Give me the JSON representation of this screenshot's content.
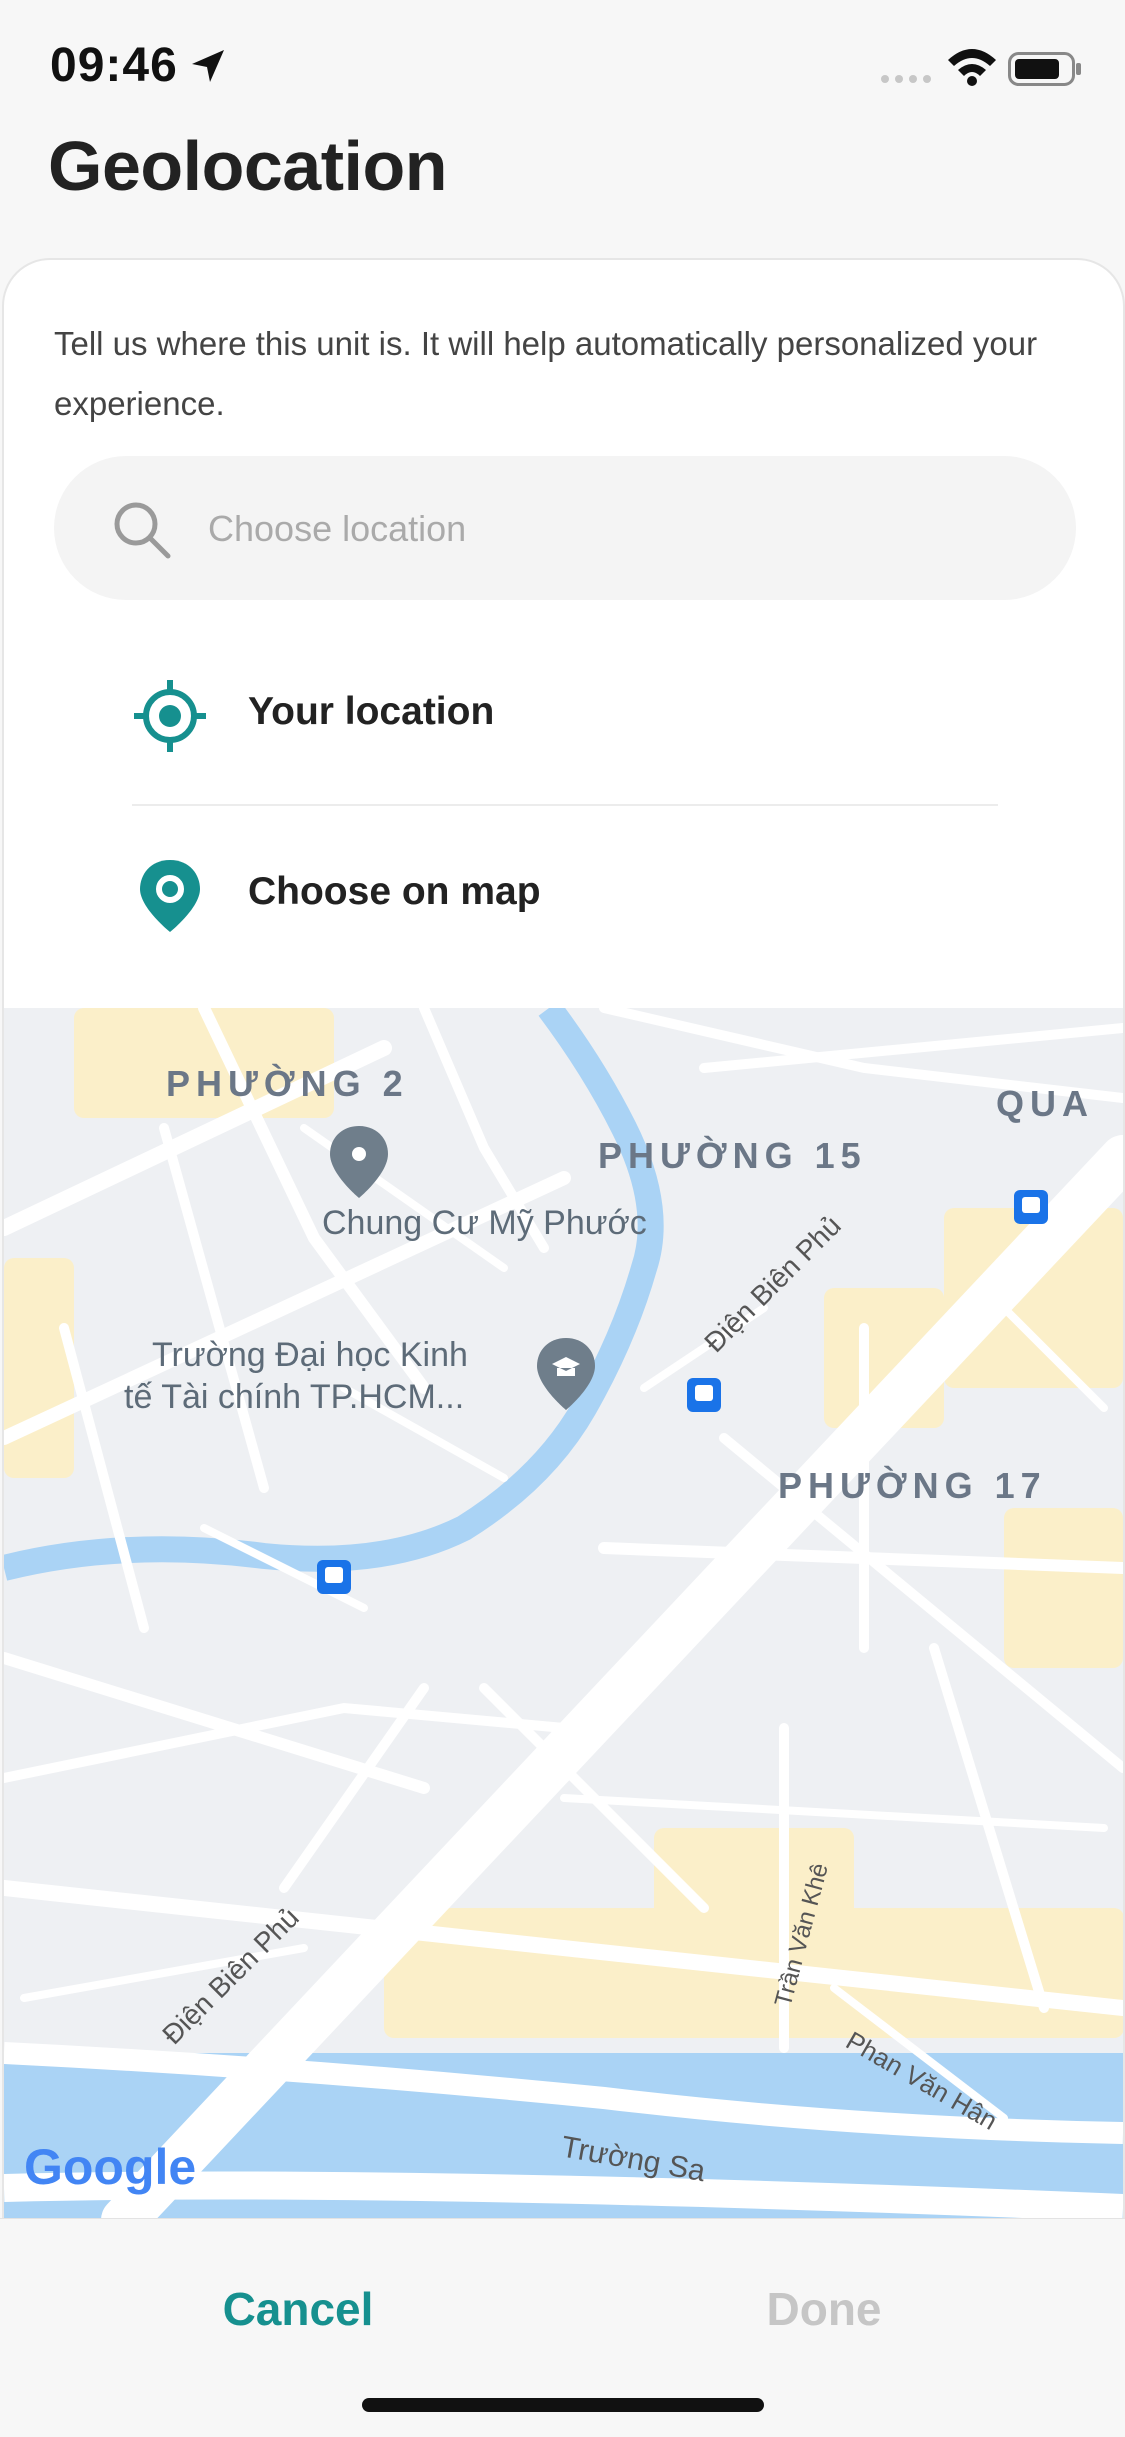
{
  "status_bar": {
    "time": "09:46"
  },
  "header": {
    "title": "Geolocation"
  },
  "sheet": {
    "description": "Tell us where this unit is. It will help automatically personalized your experience.",
    "search": {
      "placeholder": "Choose location"
    },
    "options": [
      {
        "label": "Your location",
        "icon": "crosshair-icon"
      },
      {
        "label": "Choose on map",
        "icon": "map-pin-icon"
      }
    ]
  },
  "map": {
    "labels": {
      "phuong2": "PHƯỜNG 2",
      "phuong15": "PHƯỜNG 15",
      "phuong17": "PHƯỜNG 17",
      "qua": "QUA",
      "chung_cu": "Chung Cư Mỹ Phước",
      "truong_line1": "Trường Đại học Kinh",
      "truong_line2": "tế Tài chính TP.HCM...",
      "dien_bien_phu_1": "Điện Biên Phủ",
      "dien_bien_phu_2": "Điện Biên Phủ",
      "tran_van_khe": "Trần Văn Khê",
      "phan_van_han": "Phan Văn Hân",
      "truong_sa": "Trường Sa",
      "google": "Google"
    },
    "colors": {
      "water": "#aad3f5",
      "land": "#eef0f3",
      "park": "#fbefc9",
      "road": "#ffffff",
      "pin": "#6f7e8b",
      "bus": "#1a73e8"
    }
  },
  "footer": {
    "cancel_label": "Cancel",
    "done_label": "Done"
  },
  "colors": {
    "accent": "#16908f",
    "disabled": "#c6c6c6"
  }
}
